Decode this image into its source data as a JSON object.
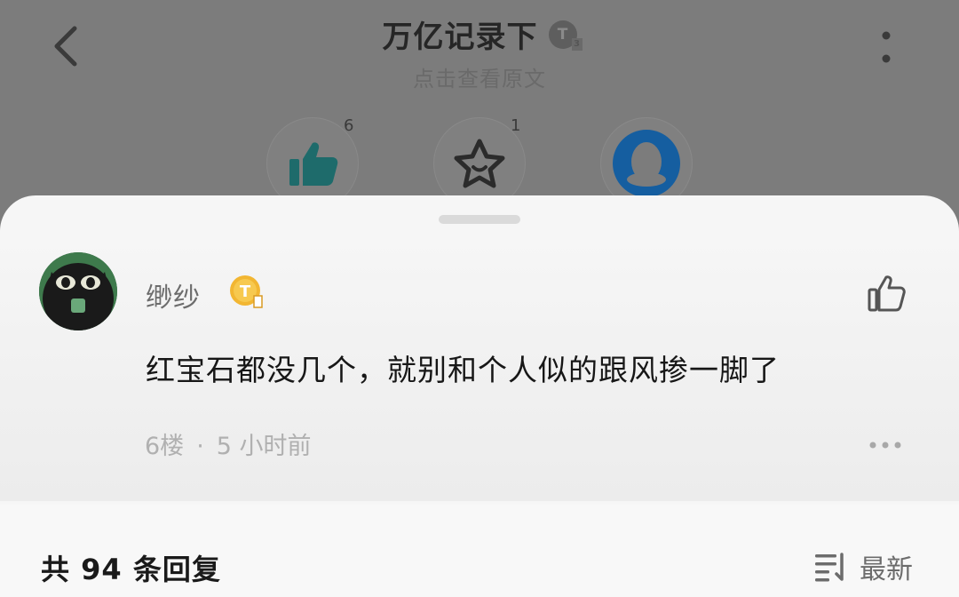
{
  "header": {
    "title": "万亿记录下",
    "title_badge_text": "T",
    "title_badge_sub": "3",
    "subtitle": "点击查看原文"
  },
  "actions": [
    {
      "icon": "thumbs-up-icon",
      "count": "6",
      "color": "#1e6b6b"
    },
    {
      "icon": "star-face-icon",
      "count": "1"
    },
    {
      "icon": "qq-penguin-icon",
      "count": "",
      "color": "#155ea0"
    }
  ],
  "comment": {
    "username": "缈纱",
    "user_badge_text": "T",
    "user_badge_sub": "1",
    "text": "红宝石都没几个，就别和个人似的跟风掺一脚了",
    "floor": "6楼",
    "separator": "·",
    "time": "5 小时前"
  },
  "replies": {
    "count_label": "共 94 条回复",
    "sort_label": "最新"
  },
  "colors": {
    "badge_gold": "#f2b632",
    "dim_overlay": "#7c7c7c",
    "sheet_bg": "#f6f6f6"
  }
}
